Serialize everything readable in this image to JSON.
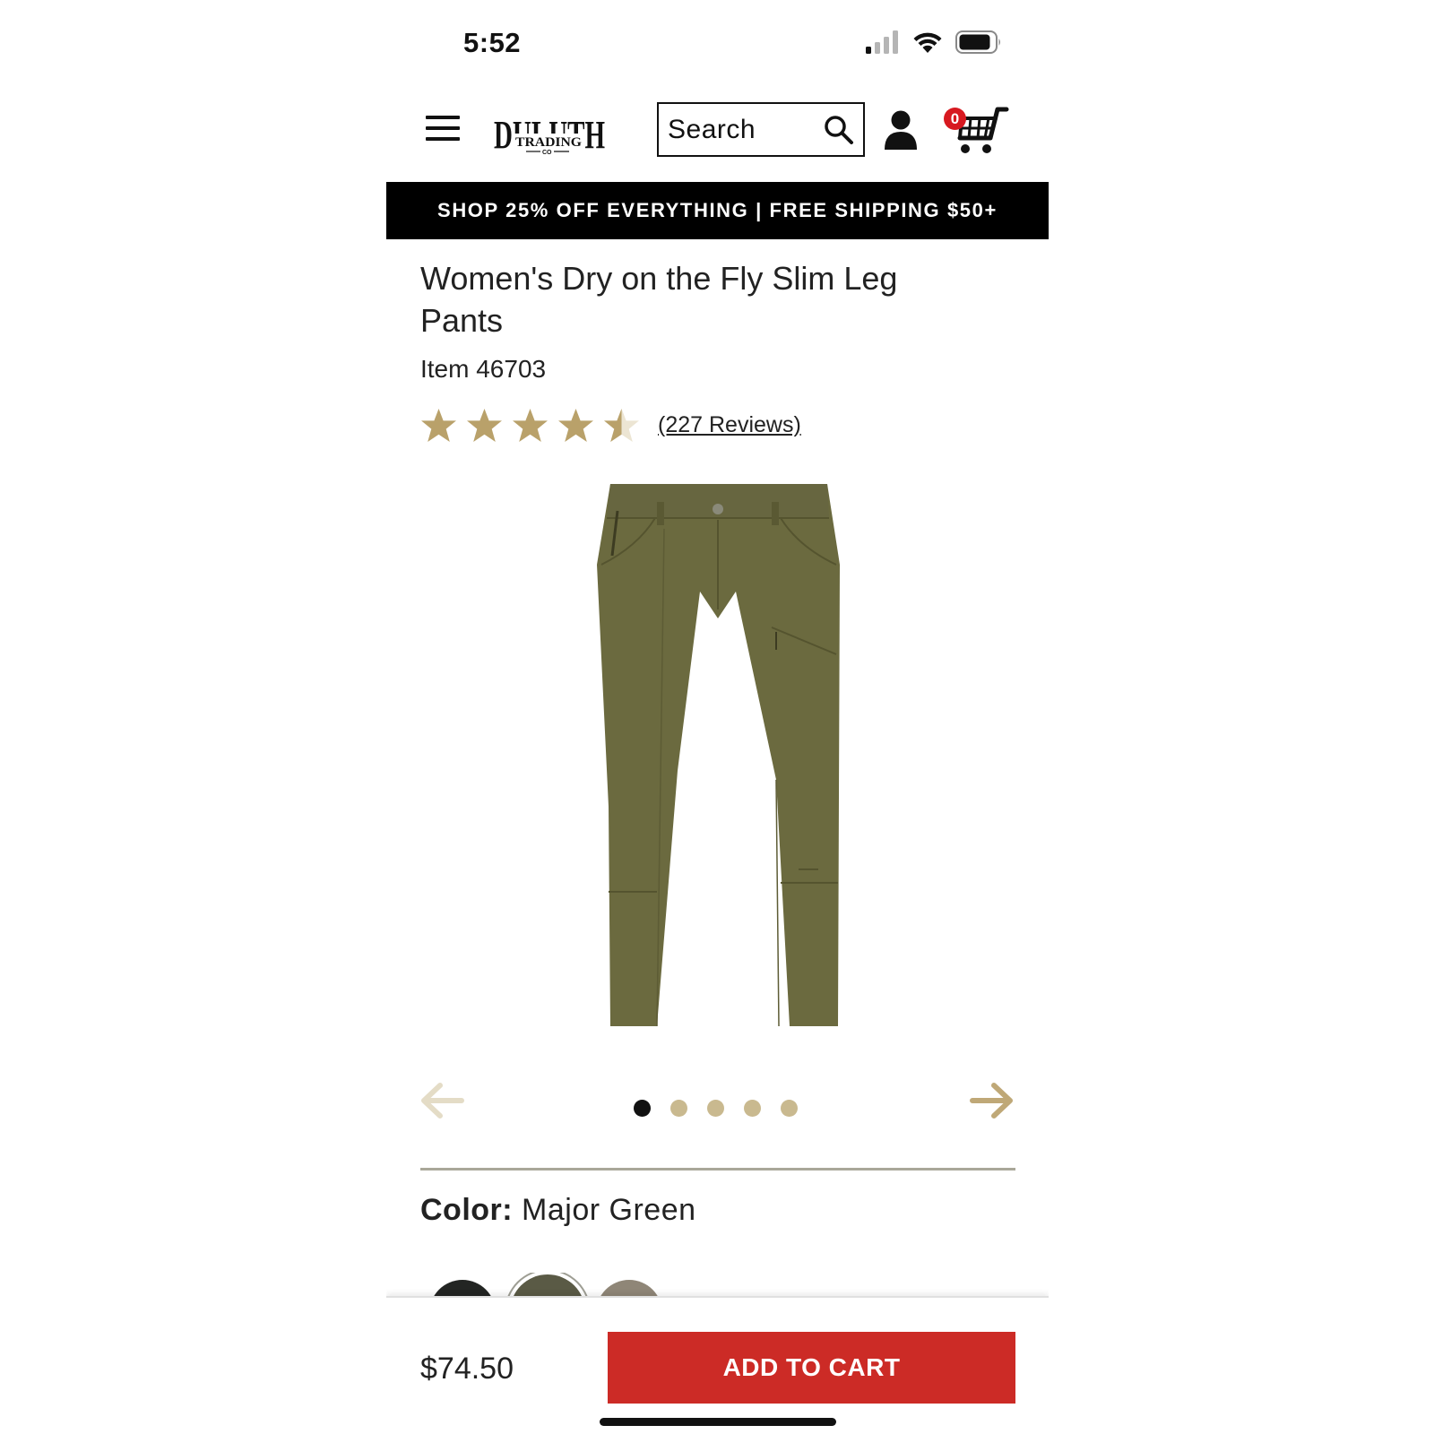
{
  "status_bar": {
    "time": "5:52"
  },
  "header": {
    "brand": {
      "name": "DULUTH",
      "sub": "TRADING",
      "co": "CO"
    },
    "search": {
      "placeholder": "Search"
    },
    "cart": {
      "count": "0"
    }
  },
  "promo": {
    "text": "SHOP 25% OFF EVERYTHING | FREE SHIPPING $50+"
  },
  "product": {
    "title": "Women's Dry on the Fly Slim Leg Pants",
    "item": "Item 46703",
    "rating": 4.5,
    "rating_max": 5,
    "reviews_label": "(227 Reviews)",
    "color_label": "Color:",
    "color_value": "Major Green",
    "image_color": "#6b6a3f"
  },
  "gallery": {
    "dots": 5,
    "active_index": 0
  },
  "swatches": [
    {
      "name": "Black",
      "color": "#232523",
      "selected": false
    },
    {
      "name": "Major Green",
      "color": "#5a5a45",
      "selected": true
    },
    {
      "name": "Khaki",
      "color": "#8f8677",
      "selected": false
    }
  ],
  "footer": {
    "price": "$74.50",
    "add_to_cart_label": "ADD TO CART"
  },
  "colors": {
    "accent_red": "#cc2b26",
    "badge_red": "#d71920",
    "star_gold": "#b9a16a",
    "dot_inactive": "#c9b98f"
  }
}
